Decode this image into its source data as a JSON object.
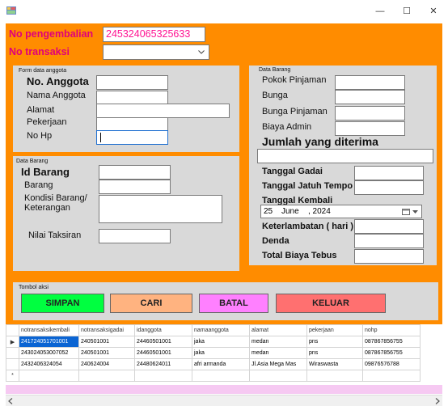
{
  "window": {
    "minimize_glyph": "—",
    "maximize_glyph": "☐",
    "close_glyph": "✕"
  },
  "header": {
    "no_pengembalian_label": "No pengembalian",
    "no_pengembalian_value": "245324065325633",
    "no_transaksi_label": "No transaksi",
    "no_transaksi_value": ""
  },
  "anggota": {
    "group_title": "Form data anggota",
    "no_anggota_label": "No. Anggota",
    "nama_label": "Nama Anggota",
    "alamat_label": "Alamat",
    "pekerjaan_label": "Pekerjaan",
    "nohp_label": "No Hp"
  },
  "barang_left": {
    "group_title": "Data Barang",
    "id_label": "Id Barang",
    "barang_label": "Barang",
    "kondisi_label_1": "Kondisi Barang/",
    "kondisi_label_2": "Keterangan",
    "nilai_label": "Nilai Taksiran"
  },
  "barang_right": {
    "group_title": "Data Barang",
    "pokok_label": "Pokok Pinjaman",
    "bunga_label": "Bunga",
    "bunga_pinjaman_label": "Bunga Pinjaman",
    "biaya_admin_label": "Biaya Admin",
    "jumlah_label": "Jumlah yang diterima",
    "tgl_gadai_label": "Tanggal Gadai",
    "tgl_jatuh_label": "Tanggal Jatuh Tempo",
    "tgl_kembali_label": "Tanggal Kembali",
    "date_day": "25",
    "date_month": "June",
    "date_year": ", 2024",
    "keterlambatan_label": "Keterlambatan ( hari )",
    "denda_label": "Denda",
    "total_label": "Total Biaya Tebus"
  },
  "aksi": {
    "group_title": "Tombol aksi",
    "simpan": "SIMPAN",
    "cari": "CARI",
    "batal": "BATAL",
    "keluar": "KELUAR"
  },
  "colors": {
    "background": "#ff8c00",
    "simpan": "#00ff40",
    "cari": "#ffb380",
    "batal": "#ff80ff",
    "keluar": "#ff7070",
    "label_accent": "#e0007a"
  },
  "grid": {
    "columns": [
      "notransaksikembali",
      "notransaksigadai",
      "idanggota",
      "namaanggota",
      "alamat",
      "pekerjaan",
      "nohp"
    ],
    "rows": [
      [
        "241724051701001",
        "240501001",
        "24460501001",
        "jaka",
        "medan",
        "pns",
        "087867856755"
      ],
      [
        "243024053007052",
        "240501001",
        "24460501001",
        "jaka",
        "medan",
        "pns",
        "087867856755"
      ],
      [
        "2432406324054",
        "240624004",
        "24480624011",
        "afri armanda",
        "Jl.Asia Mega Mas",
        "Wiraswasta",
        "09876576788"
      ]
    ],
    "current_row_marker": "▶",
    "new_row_marker": "*"
  }
}
